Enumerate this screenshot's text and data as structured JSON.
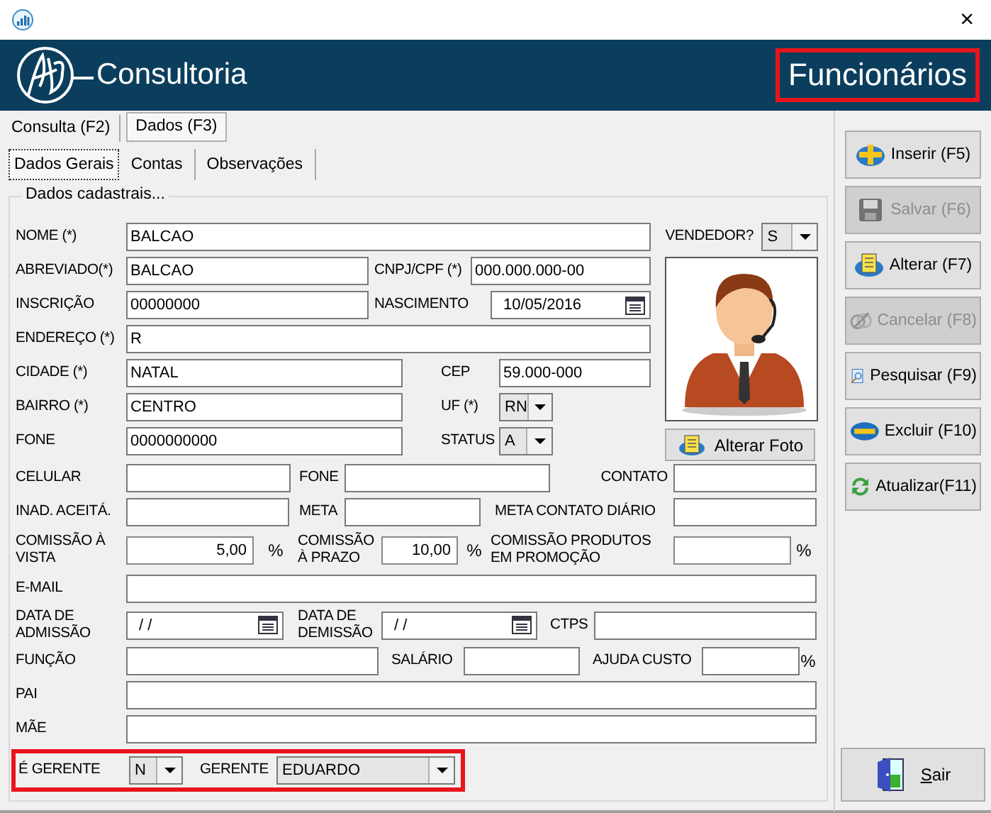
{
  "window": {
    "close": "×"
  },
  "header": {
    "brand": "Consultoria",
    "title": "Funcionários",
    "title_highlighted": true
  },
  "tabs": [
    {
      "label": "Consulta (F2)",
      "selected": false
    },
    {
      "label": "Dados (F3)",
      "selected": true
    }
  ],
  "subtabs": [
    {
      "label": "Dados Gerais",
      "selected": true
    },
    {
      "label": "Contas",
      "selected": false
    },
    {
      "label": "Observações",
      "selected": false
    }
  ],
  "group": {
    "title": "Dados cadastrais..."
  },
  "fields": {
    "nome": {
      "label": "NOME (*)",
      "kind": "text",
      "value": "BALCAO"
    },
    "abreviado": {
      "label": "ABREVIADO(*)",
      "kind": "text",
      "value": "BALCAO"
    },
    "cnpj": {
      "label": "CNPJ/CPF (*)",
      "kind": "text",
      "value": "000.000.000-00"
    },
    "inscricao": {
      "label": "INSCRIÇÃO",
      "kind": "text",
      "value": "00000000"
    },
    "nascimento": {
      "label": "NASCIMENTO",
      "kind": "date",
      "value": "10/05/2016"
    },
    "endereco": {
      "label": "ENDEREÇO (*)",
      "kind": "text",
      "value": "R"
    },
    "cidade": {
      "label": "CIDADE (*)",
      "kind": "text",
      "value": "NATAL"
    },
    "cep": {
      "label": "CEP",
      "kind": "text",
      "value": "59.000-000"
    },
    "bairro": {
      "label": "BAIRRO (*)",
      "kind": "text",
      "value": "CENTRO"
    },
    "uf": {
      "label": "UF (*)",
      "kind": "combo",
      "value": "RN"
    },
    "fone": {
      "label": "FONE",
      "kind": "text",
      "value": "0000000000"
    },
    "status": {
      "label": "STATUS",
      "kind": "combo",
      "value": "A"
    },
    "vendedor": {
      "label": "VENDEDOR?",
      "kind": "combo",
      "value": "S"
    },
    "celular": {
      "label": "CELULAR",
      "kind": "text"
    },
    "fone2": {
      "label": "FONE",
      "kind": "text"
    },
    "contato": {
      "label": "CONTATO",
      "kind": "text"
    },
    "inad": {
      "label": "INAD. ACEITÁ.",
      "kind": "text"
    },
    "meta": {
      "label": "META",
      "kind": "text"
    },
    "meta_diario": {
      "label": "META CONTATO DIÁRIO",
      "kind": "text"
    },
    "comissao_vista": {
      "label": "COMISSÃO À VISTA",
      "kind": "number",
      "value": "5,00",
      "unit": "%"
    },
    "comissao_prazo": {
      "label": "COMISSÃO À PRAZO",
      "kind": "number",
      "value": "10,00",
      "unit": "%"
    },
    "comissao_promocao": {
      "label": "COMISSÃO PRODUTOS EM PROMOÇÃO",
      "kind": "number",
      "unit": "%"
    },
    "email": {
      "label": "E-MAIL",
      "kind": "text"
    },
    "admissao": {
      "label": "DATA DE ADMISSÃO",
      "kind": "date",
      "value": "/ /"
    },
    "demissao": {
      "label": "DATA DE DEMISSÃO",
      "kind": "date",
      "value": "/ /"
    },
    "ctps": {
      "label": "CTPS",
      "kind": "text"
    },
    "funcao": {
      "label": "FUNÇÃO",
      "kind": "text"
    },
    "salario": {
      "label": "SALÁRIO",
      "kind": "text"
    },
    "ajuda_custo": {
      "label": "AJUDA CUSTO",
      "kind": "text",
      "unit": "%"
    },
    "pai": {
      "label": "PAI",
      "kind": "text"
    },
    "mae": {
      "label": "MÃE",
      "kind": "text"
    },
    "e_gerente": {
      "label": "É GERENTE",
      "kind": "combo",
      "value": "N"
    },
    "gerente": {
      "label": "GERENTE",
      "kind": "combo",
      "value": "EDUARDO"
    }
  },
  "gerente_row_highlighted": true,
  "photo_button": {
    "label": "Alterar Foto"
  },
  "actions": [
    {
      "label": "Inserir (F5)",
      "kind": "plus",
      "disabled": false
    },
    {
      "label": "Salvar (F6)",
      "kind": "save",
      "disabled": true
    },
    {
      "label": "Alterar (F7)",
      "kind": "note",
      "disabled": false
    },
    {
      "label": "Cancelar (F8)",
      "kind": "cancel",
      "disabled": true
    },
    {
      "label": "Pesquisar (F9)",
      "kind": "search",
      "disabled": false
    },
    {
      "label": "Excluir (F10)",
      "kind": "minus",
      "disabled": false
    },
    {
      "label": "Atualizar(F11)",
      "kind": "refresh",
      "disabled": false
    }
  ],
  "exit": {
    "label": "Sair"
  }
}
